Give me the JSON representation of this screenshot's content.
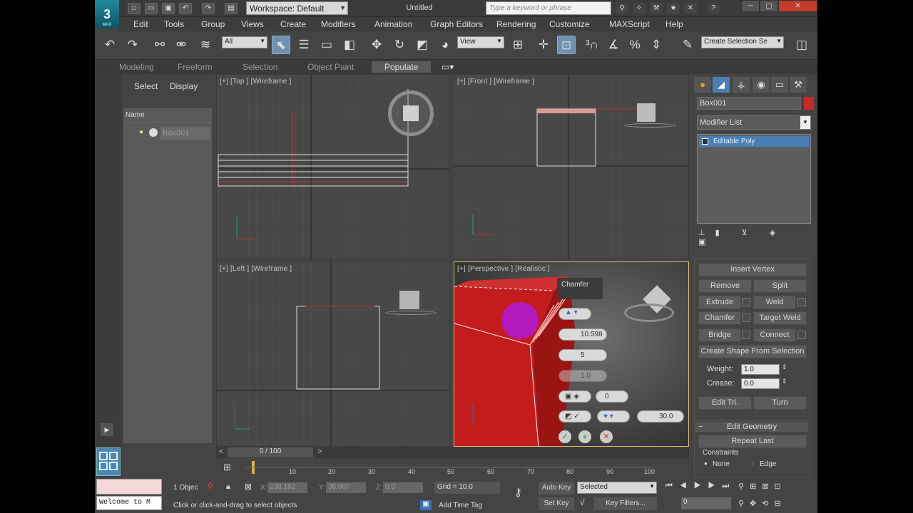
{
  "titlebar": {
    "workspace": "Workspace: Default",
    "document_title": "Untitled",
    "search_placeholder": "Type a keyword or phrase"
  },
  "menu": [
    "Edit",
    "Tools",
    "Group",
    "Views",
    "Create",
    "Modifiers",
    "Animation",
    "Graph Editors",
    "Rendering",
    "Customize",
    "MAXScript",
    "Help"
  ],
  "toolbar": {
    "selection_filter": "All",
    "ref_coord": "View",
    "named_selection": "Create Selection Se"
  },
  "ribbon_tabs": [
    "Modeling",
    "Freeform",
    "Selection",
    "Object Paint",
    "Populate"
  ],
  "explorer": {
    "tabs": [
      "Select",
      "Display"
    ],
    "column_name": "Name",
    "object": "Box001"
  },
  "viewports": {
    "top": "[+] [Top ] [Wireframe ]",
    "front": "[+] [Front ] [Wireframe ]",
    "left": "[+] [Left ] [Wireframe ]",
    "perspective": "[+] [Perspective ] [Realistic ]"
  },
  "caddy": {
    "title": "Chamfer",
    "amount": "10.598",
    "segments": "5",
    "tension": "1.0",
    "open": "0",
    "angle": "30.0"
  },
  "command_panel": {
    "object_name": "Box001",
    "modifier_list": "Modifier List",
    "stack_item": "Editable Poly",
    "buttons": {
      "insert_vertex": "Insert Vertex",
      "remove": "Remove",
      "split": "Split",
      "extrude": "Extrude",
      "weld": "Weld",
      "chamfer": "Chamfer",
      "target_weld": "Target Weld",
      "bridge": "Bridge",
      "connect": "Connect",
      "create_shape": "Create Shape From Selection",
      "edit_tri": "Edit Tri.",
      "turn": "Turn",
      "repeat_last": "Repeat Last"
    },
    "weight_label": "Weight:",
    "weight": "1.0",
    "crease_label": "Crease:",
    "crease": "0.0",
    "rollout": "Edit Geometry",
    "constraints_label": "Constraints",
    "none": "None",
    "edge": "Edge"
  },
  "timeline": {
    "frame": "0 / 100",
    "ticks": [
      "10",
      "20",
      "30",
      "40",
      "50",
      "60",
      "70",
      "80",
      "90",
      "100"
    ]
  },
  "status": {
    "maxscript": "Welcome to M",
    "objects": "1 Objec",
    "x_label": "X:",
    "x": "238.182",
    "y_label": "Y:",
    "y": "36.907",
    "z_label": "Z:",
    "z": "0.0",
    "grid": "Grid = 10.0",
    "prompt": "Click or click-and-drag to select objects",
    "add_time_tag": "Add Time Tag",
    "auto_key": "Auto Key",
    "selected": "Selected",
    "set_key": "Set Key",
    "key_filters": "Key Filters...",
    "frame": "0"
  }
}
